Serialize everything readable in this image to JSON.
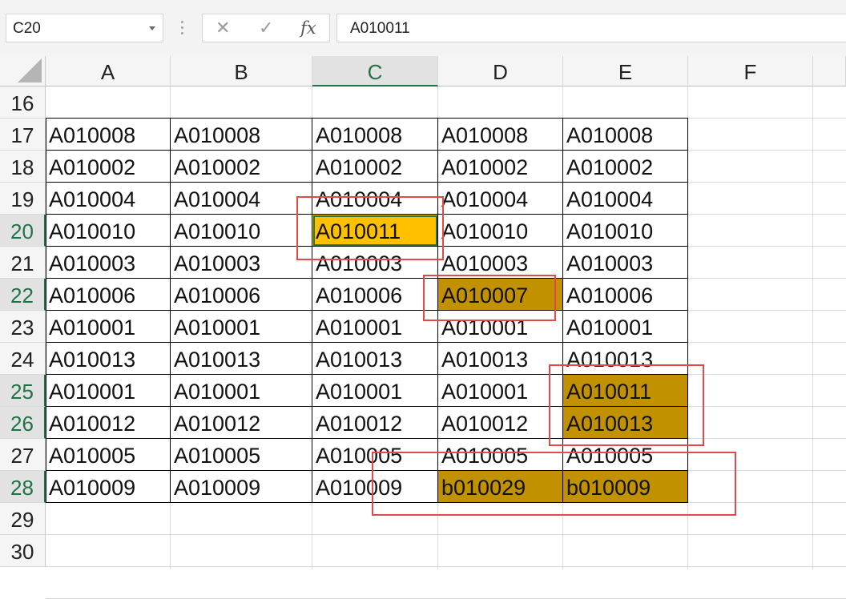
{
  "name_box": {
    "value": "C20"
  },
  "formula_bar": {
    "cancel_glyph": "✕",
    "enter_glyph": "✓",
    "fx_label": "fx",
    "value": "A010011"
  },
  "columns": [
    "A",
    "B",
    "C",
    "D",
    "E",
    "F"
  ],
  "selected_column": "C",
  "selected_rows": [
    20,
    22,
    25,
    26,
    28
  ],
  "rows": [
    {
      "num": "16",
      "cells": [
        "",
        "",
        "",
        "",
        ""
      ]
    },
    {
      "num": "17",
      "cells": [
        "A010008",
        "A010008",
        "A010008",
        "A010008",
        "A010008"
      ]
    },
    {
      "num": "18",
      "cells": [
        "A010002",
        "A010002",
        "A010002",
        "A010002",
        "A010002"
      ]
    },
    {
      "num": "19",
      "cells": [
        "A010004",
        "A010004",
        "A010004",
        "A010004",
        "A010004"
      ]
    },
    {
      "num": "20",
      "cells": [
        "A010010",
        "A010010",
        "A010011",
        "A010010",
        "A010010"
      ]
    },
    {
      "num": "21",
      "cells": [
        "A010003",
        "A010003",
        "A010003",
        "A010003",
        "A010003"
      ]
    },
    {
      "num": "22",
      "cells": [
        "A010006",
        "A010006",
        "A010006",
        "A010007",
        "A010006"
      ]
    },
    {
      "num": "23",
      "cells": [
        "A010001",
        "A010001",
        "A010001",
        "A010001",
        "A010001"
      ]
    },
    {
      "num": "24",
      "cells": [
        "A010013",
        "A010013",
        "A010013",
        "A010013",
        "A010013"
      ]
    },
    {
      "num": "25",
      "cells": [
        "A010001",
        "A010001",
        "A010001",
        "A010001",
        "A010011"
      ]
    },
    {
      "num": "26",
      "cells": [
        "A010012",
        "A010012",
        "A010012",
        "A010012",
        "A010013"
      ]
    },
    {
      "num": "27",
      "cells": [
        "A010005",
        "A010005",
        "A010005",
        "A010005",
        "A010005"
      ]
    },
    {
      "num": "28",
      "cells": [
        "A010009",
        "A010009",
        "A010009",
        "b010029",
        "b010009"
      ]
    },
    {
      "num": "29",
      "cells": [
        "",
        "",
        "",
        "",
        ""
      ]
    },
    {
      "num": "30",
      "cells": [
        "",
        "",
        "",
        "",
        ""
      ]
    }
  ],
  "highlights": {
    "yellow": [
      "C20"
    ],
    "gold": [
      "D22",
      "E25",
      "E26",
      "D28",
      "E28"
    ]
  },
  "colors": {
    "highlight_gold": "#c19100",
    "highlight_yellow": "#ffc000",
    "annotation_red": "#e34949",
    "excel_green": "#217346"
  }
}
